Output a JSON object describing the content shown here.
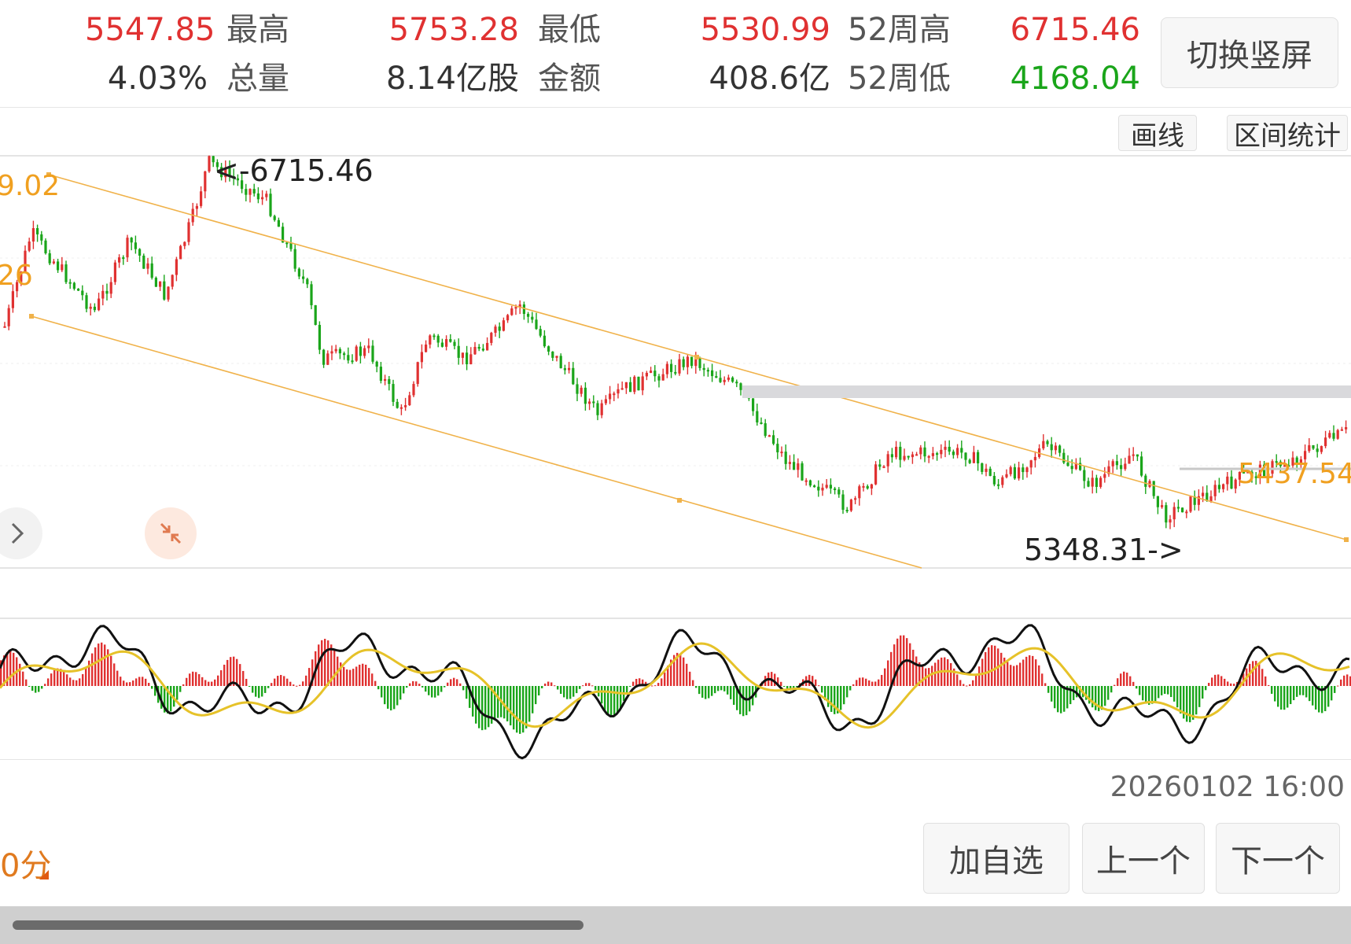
{
  "stats": {
    "row1": [
      {
        "value": "5547.85",
        "color": "red"
      },
      {
        "label": "最高"
      },
      {
        "value": "5753.28",
        "color": "red"
      },
      {
        "label": "最低"
      },
      {
        "value": "5530.99",
        "color": "red"
      },
      {
        "label": "52周高"
      },
      {
        "value": "6715.46",
        "color": "red"
      }
    ],
    "open_price": "5547.85",
    "high_label": "最高",
    "high_value": "5753.28",
    "low_label": "最低",
    "low_value": "5530.99",
    "week52_high_label": "52周高",
    "week52_high_value": "6715.46",
    "change_pct": "4.03%",
    "volume_label": "总量",
    "volume_value": "8.14亿股",
    "amount_label": "金额",
    "amount_value": "408.6亿",
    "week52_low_label": "52周低",
    "week52_low_value": "4168.04"
  },
  "rotate_button": "切换竖屏",
  "toolbar": {
    "draw_label": "画线",
    "range_stats_label": "区间统计"
  },
  "chart_labels": {
    "left_price_1": "9.02",
    "left_price_2": "26",
    "peak_annotation": "<-6715.46",
    "trough_annotation": "5348.31->",
    "right_price": "5437.54"
  },
  "timestamp": "20260102 16:00",
  "period_label": "0分",
  "actions": {
    "add_watch": "加自选",
    "prev": "上一个",
    "next": "下一个"
  },
  "colors": {
    "up": "#e03131",
    "down": "#1aa51a",
    "channel": "#f0b24a",
    "dif": "#111111",
    "dea": "#e6c229"
  },
  "icons": {
    "expand": "chevron-right-icon",
    "collapse": "collapse-arrows-icon"
  }
}
